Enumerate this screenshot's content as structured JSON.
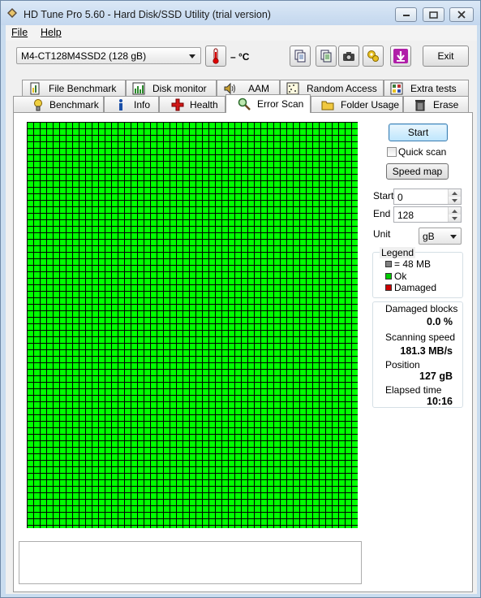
{
  "window": {
    "title": "HD Tune Pro 5.60 - Hard Disk/SSD Utility (trial version)"
  },
  "menu": {
    "file_label": "File",
    "help_label": "Help"
  },
  "toolbar": {
    "drive": "M4-CT128M4SSD2 (128 gB)",
    "temperature": "– °C",
    "exit_label": "Exit"
  },
  "tabs_top": [
    {
      "label": "File Benchmark",
      "icon": "file-benchmark-icon"
    },
    {
      "label": "Disk monitor",
      "icon": "disk-monitor-icon"
    },
    {
      "label": "AAM",
      "icon": "speaker-icon"
    },
    {
      "label": "Random Access",
      "icon": "random-access-icon"
    },
    {
      "label": "Extra tests",
      "icon": "extra-tests-icon"
    }
  ],
  "tabs_bottom": [
    {
      "label": "Benchmark",
      "icon": "benchmark-icon"
    },
    {
      "label": "Info",
      "icon": "info-icon"
    },
    {
      "label": "Health",
      "icon": "health-cross-icon"
    },
    {
      "label": "Error Scan",
      "icon": "magnifier-icon",
      "active": true
    },
    {
      "label": "Folder Usage",
      "icon": "folder-icon"
    },
    {
      "label": "Erase",
      "icon": "trash-icon"
    }
  ],
  "scan": {
    "start_button": "Start",
    "quick_scan_label": "Quick scan",
    "quick_scan_checked": false,
    "speed_map_button": "Speed map",
    "start_label": "Start",
    "start_value": "0",
    "end_label": "End",
    "end_value": "128",
    "unit_label": "Unit",
    "unit_value": "gB",
    "grid_color": "#00ff00",
    "grid_line_color": "#000000"
  },
  "legend": {
    "title": "Legend",
    "block_size": "= 48 MB",
    "ok": "Ok",
    "damaged": "Damaged",
    "block_color": "#808080",
    "ok_color": "#00cc00",
    "damaged_color": "#cc0000"
  },
  "stats": {
    "damaged_blocks_label": "Damaged blocks",
    "damaged_blocks_value": "0.0 %",
    "scanning_speed_label": "Scanning speed",
    "scanning_speed_value": "181.3 MB/s",
    "position_label": "Position",
    "position_value": "127 gB",
    "elapsed_label": "Elapsed time",
    "elapsed_value": "10:16"
  }
}
